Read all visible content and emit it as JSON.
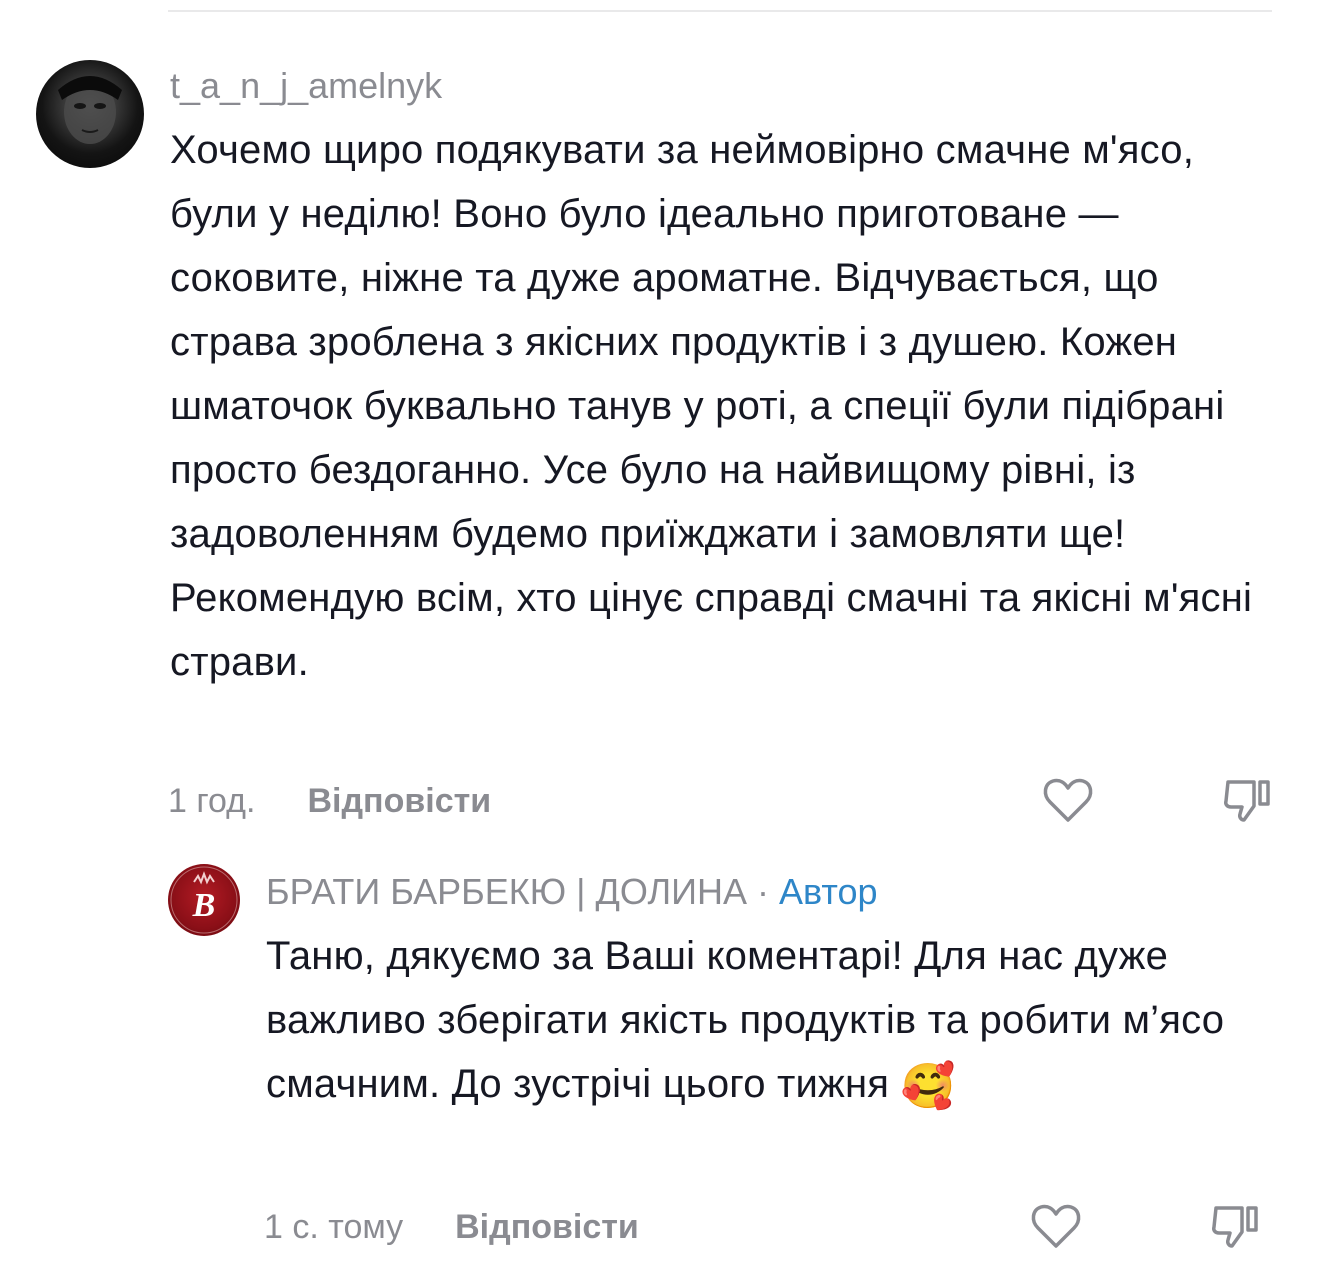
{
  "comments": [
    {
      "username": "t_a_n_j_amelnyk",
      "text": "Хочемо щиро подякувати за неймовірно смачне м'ясо, були у неділю! Воно було ідеально приготоване — соковите, ніжне та дуже ароматне. Відчувається, що страва зроблена з якісних продуктів і з душею. Кожен шматочок буквально танув у роті, а спеції були підібрані просто бездоганно. Усе було на найвищому рівні, із задоволенням будемо приїжджати і замовляти ще! Рекомендую всім, хто цінує справді смачні та якісні м'ясні страви.",
      "time": "1 год.",
      "reply_label": "Відповісти",
      "icons": {
        "avatar": "profile-photo-avatar",
        "like": "heart-icon",
        "dislike": "thumbs-down-icon"
      }
    },
    {
      "username": "БРАТИ БАРБЕКЮ | ДОЛИНА",
      "separator": "·",
      "author_badge": "Автор",
      "text": "Таню, дякуємо за Ваші коментарі! Для нас дуже важливо зберігати якість продуктів та робити м’ясо смачним. До зустрічі цього тижня",
      "emoji": "🥰",
      "time": "1 с. тому",
      "reply_label": "Відповісти",
      "icons": {
        "avatar": "brand-logo-avatar",
        "like": "heart-icon",
        "dislike": "thumbs-down-icon"
      }
    }
  ],
  "colors": {
    "text": "#161823",
    "muted": "#8a8b91",
    "author_badge": "#2e86c8",
    "brand_red": "#8a0f17"
  }
}
